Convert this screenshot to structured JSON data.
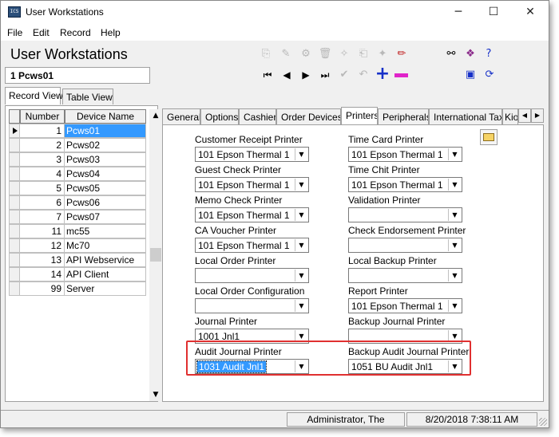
{
  "window": {
    "title": "User Workstations",
    "controls": {
      "minimize": "─",
      "maximize": "☐",
      "close": "✕"
    }
  },
  "app_icon_text": "ICS",
  "menu": [
    "File",
    "Edit",
    "Record",
    "Help"
  ],
  "page_title": "User Workstations",
  "current_record": "1  Pcws01",
  "toolbar": {
    "icons": [
      "copy-icon",
      "copy-special-icon",
      "tree-icon",
      "delete-icon",
      "wand-icon",
      "paste-icon",
      "wand2-icon",
      "pencil-icon",
      "binoculars-icon",
      "book-icon",
      "help-cursor-icon",
      "screen-icon",
      "refresh-icon"
    ],
    "nav": {
      "first": "⏮",
      "prev": "◀",
      "next": "▶",
      "last": "⏭",
      "check": "✔",
      "undo": "↶",
      "add": "+",
      "delete": "−"
    }
  },
  "left_tabs": [
    "Record View",
    "Table View"
  ],
  "grid": {
    "headers": [
      "Number",
      "Device Name"
    ],
    "rows": [
      {
        "number": "1",
        "name": "Pcws01"
      },
      {
        "number": "2",
        "name": "Pcws02"
      },
      {
        "number": "3",
        "name": "Pcws03"
      },
      {
        "number": "4",
        "name": "Pcws04"
      },
      {
        "number": "5",
        "name": "Pcws05"
      },
      {
        "number": "6",
        "name": "Pcws06"
      },
      {
        "number": "7",
        "name": "Pcws07"
      },
      {
        "number": "11",
        "name": "mc55"
      },
      {
        "number": "12",
        "name": "Mc70"
      },
      {
        "number": "13",
        "name": "API Webservice"
      },
      {
        "number": "14",
        "name": "API Client"
      },
      {
        "number": "99",
        "name": "Server"
      }
    ],
    "selected_index": 0
  },
  "right_tabs": [
    "General",
    "Options",
    "Cashier",
    "Order Devices",
    "Printers",
    "Peripherals",
    "International Tax",
    "Kio"
  ],
  "active_right_tab": "Printers",
  "printers": {
    "customer_receipt": {
      "label": "Customer Receipt Printer",
      "value": "101  Epson Thermal 1"
    },
    "time_card": {
      "label": "Time Card Printer",
      "value": "101  Epson Thermal 1"
    },
    "guest_check": {
      "label": "Guest Check Printer",
      "value": "101  Epson Thermal 1"
    },
    "time_chit": {
      "label": "Time Chit Printer",
      "value": "101  Epson Thermal 1"
    },
    "memo_check": {
      "label": "Memo Check Printer",
      "value": "101  Epson Thermal 1"
    },
    "validation": {
      "label": "Validation Printer",
      "value": ""
    },
    "ca_voucher": {
      "label": "CA Voucher Printer",
      "value": "101  Epson Thermal 1"
    },
    "check_endorsement": {
      "label": "Check Endorsement Printer",
      "value": ""
    },
    "local_order": {
      "label": "Local Order Printer",
      "value": ""
    },
    "local_backup": {
      "label": "Local Backup Printer",
      "value": ""
    },
    "local_order_config": {
      "label": "Local Order Configuration",
      "value": ""
    },
    "report": {
      "label": "Report Printer",
      "value": "101  Epson Thermal 1"
    },
    "journal": {
      "label": "Journal Printer",
      "value": "1001  Jnl1"
    },
    "backup_journal": {
      "label": "Backup Journal Printer",
      "value": ""
    },
    "audit_journal": {
      "label": "Audit Journal Printer",
      "value": "1031  Audit Jnl1"
    },
    "backup_audit_journal": {
      "label": "Backup Audit Journal Printer",
      "value": "1051  BU Audit Jnl1"
    }
  },
  "status": {
    "user": "Administrator, The",
    "datetime": "8/20/2018 7:38:11 AM"
  },
  "colors": {
    "selection": "#3399ff",
    "highlight_box": "#e03030",
    "add_button": "#1630c8",
    "delete_button": "#e024c9"
  }
}
